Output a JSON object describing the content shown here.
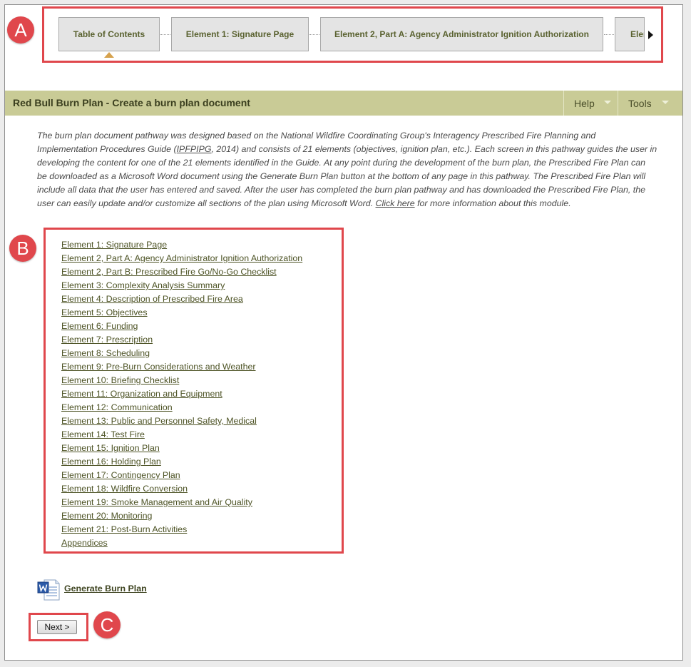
{
  "markers": {
    "a": "A",
    "b": "B",
    "c": "C"
  },
  "steps": [
    {
      "label": "Table of Contents"
    },
    {
      "label": "Element 1: Signature Page"
    },
    {
      "label": "Element 2, Part A: Agency Administrator Ignition Authorization"
    },
    {
      "label": "Elem"
    }
  ],
  "header": {
    "title": "Red Bull Burn Plan - Create a burn plan document",
    "help_label": "Help",
    "tools_label": "Tools"
  },
  "intro": {
    "part1": "The burn plan document pathway was designed based on the National Wildfire Coordinating Group's Interagency Prescribed Fire Planning and Implementation Procedures Guide (",
    "guide_link": "IPFPIPG",
    "part2": ", 2014) and consists of 21 elements (objectives, ignition plan, etc.). Each screen in this pathway guides the user in developing the content for one of the 21 elements identified in the Guide. At any point during the development of the burn plan, the Prescribed Fire Plan can be downloaded as a Microsoft Word document using the Generate Burn Plan button at the bottom of any page in this pathway. The Prescribed Fire Plan will include all data that the user has entered and saved. After the user has completed the burn plan pathway and has downloaded the Prescribed Fire Plan, the user can easily update and/or customize all sections of the plan using Microsoft Word. ",
    "click_here": "Click here",
    "part3": " for more information about this module."
  },
  "elements": [
    "Element 1: Signature Page",
    "Element 2, Part A: Agency Administrator Ignition Authorization",
    "Element 2, Part B: Prescribed Fire Go/No-Go Checklist",
    "Element 3: Complexity Analysis Summary",
    "Element 4: Description of Prescribed Fire Area",
    "Element 5: Objectives",
    "Element 6: Funding",
    "Element 7: Prescription",
    "Element 8: Scheduling",
    "Element 9: Pre-Burn Considerations and Weather",
    "Element 10: Briefing Checklist",
    "Element 11: Organization and Equipment",
    "Element 12: Communication",
    "Element 13: Public and Personnel Safety, Medical",
    "Element 14: Test Fire",
    "Element 15: Ignition Plan",
    "Element 16: Holding Plan",
    "Element 17: Contingency Plan",
    "Element 18: Wildfire Conversion",
    "Element 19: Smoke Management and Air Quality",
    "Element 20: Monitoring",
    "Element 21: Post-Burn Activities",
    "Appendices"
  ],
  "generate": {
    "label": "Generate Burn Plan",
    "icon": "word-document-icon"
  },
  "next": {
    "label": "Next >"
  },
  "colors": {
    "annotation": "#e0474c",
    "header_bg": "#c9cb96",
    "link": "#4d5325"
  }
}
